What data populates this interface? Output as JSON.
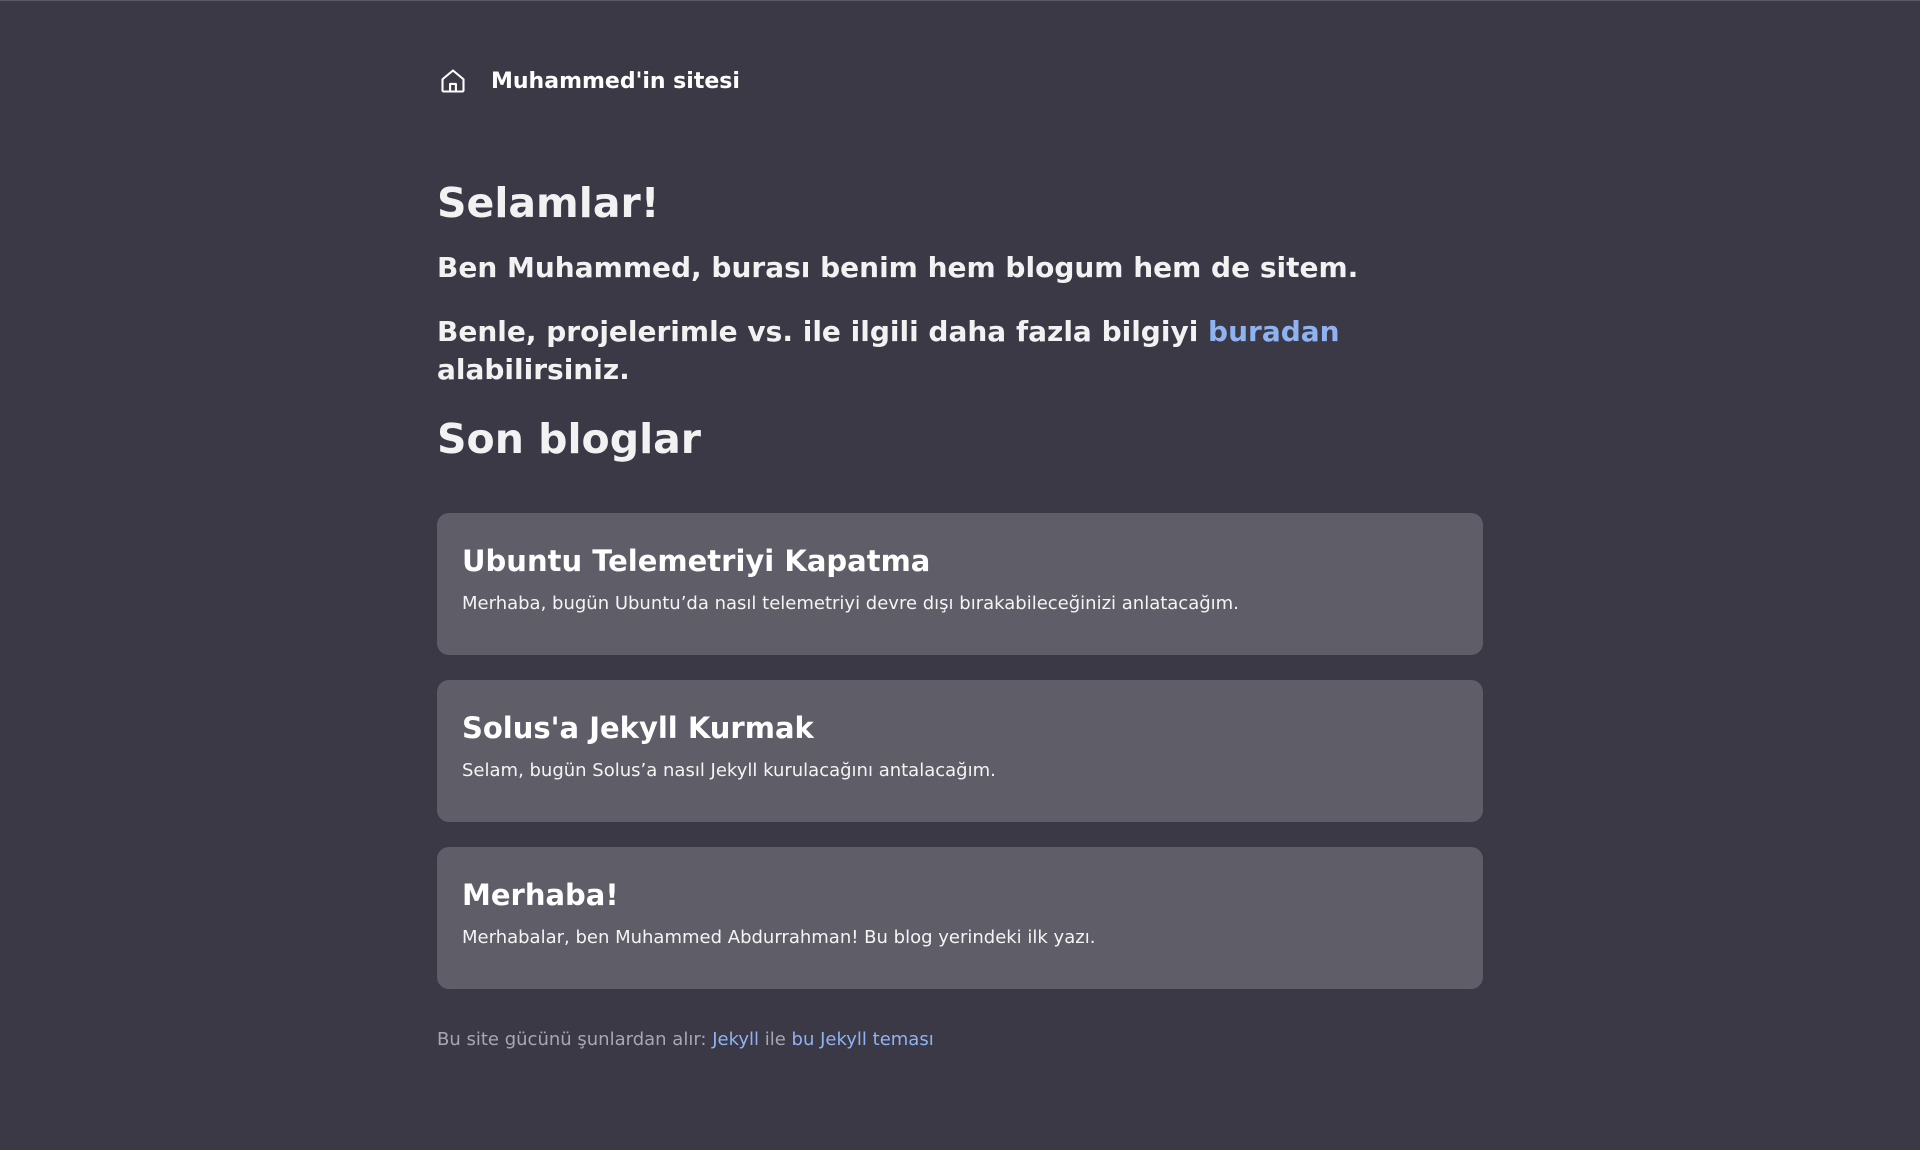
{
  "header": {
    "icon": "home-icon",
    "title": "Muhammed'in sitesi"
  },
  "intro": {
    "greeting": "Selamlar!",
    "line1": "Ben Muhammed, burası benim hem blogum hem de sitem.",
    "line2_before": "Benle, projelerimle vs. ile ilgili daha fazla bilgiyi ",
    "line2_link": "buradan",
    "line2_after": " alabilirsiniz."
  },
  "recent": {
    "heading": "Son bloglar",
    "posts": [
      {
        "title": "Ubuntu Telemetriyi Kapatma",
        "excerpt": "Merhaba, bugün Ubuntu’da nasıl telemetriyi devre dışı bırakabileceğinizi anlatacağım."
      },
      {
        "title": "Solus'a Jekyll Kurmak",
        "excerpt": "Selam, bugün Solus’a nasıl Jekyll kurulacağını antalacağım."
      },
      {
        "title": "Merhaba!",
        "excerpt": "Merhabalar, ben Muhammed Abdurrahman! Bu blog yerindeki ilk yazı."
      }
    ]
  },
  "footer": {
    "prefix": "Bu site gücünü şunlardan alır: ",
    "link1": "Jekyll",
    "middle": " ile ",
    "link2": "bu Jekyll teması"
  },
  "colors": {
    "background": "#3c3947",
    "card": "#5f5d67",
    "link": "#8fb3f0"
  }
}
